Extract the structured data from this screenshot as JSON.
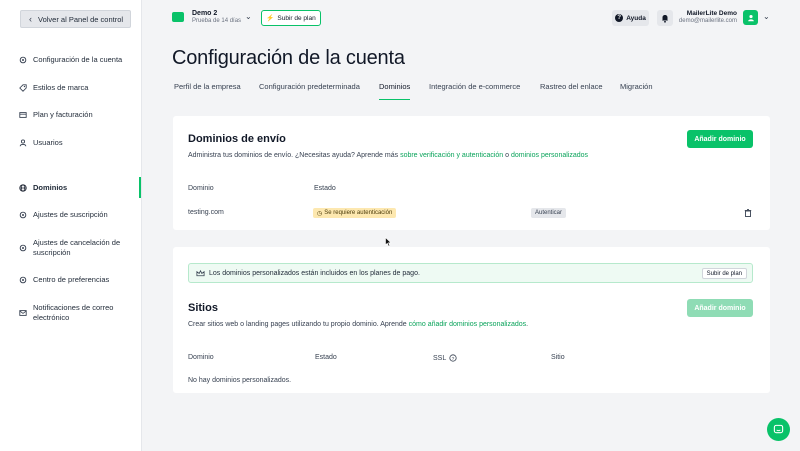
{
  "sidebar": {
    "back_label": "Volver al Panel de control",
    "items": [
      {
        "label": "Configuración de la cuenta",
        "icon": "gear-icon"
      },
      {
        "label": "Estilos de marca",
        "icon": "tag-icon"
      },
      {
        "label": "Plan y facturación",
        "icon": "card-icon"
      },
      {
        "label": "Usuarios",
        "icon": "user-icon"
      },
      {
        "label": "Dominios",
        "icon": "globe-icon",
        "active": true
      },
      {
        "label": "Ajustes de suscripción",
        "icon": "gear-icon"
      },
      {
        "label": "Ajustes de cancelación de suscripción",
        "icon": "gear-icon"
      },
      {
        "label": "Centro de preferencias",
        "icon": "gear-icon"
      },
      {
        "label": "Notificaciones de correo electrónico",
        "icon": "mail-icon"
      }
    ]
  },
  "topbar": {
    "account_name": "Demo 2",
    "account_trial": "Prueba de 14 días",
    "upgrade_label": "Subir de plan",
    "help_label": "Ayuda",
    "user_name": "MailerLite Demo",
    "user_email": "demo@mailerlite.com"
  },
  "page": {
    "title": "Configuración de la cuenta",
    "tabs": [
      {
        "label": "Perfil de la empresa"
      },
      {
        "label": "Configuración predeterminada"
      },
      {
        "label": "Dominios",
        "active": true
      },
      {
        "label": "Integración de e-commerce"
      },
      {
        "label": "Rastreo del enlace"
      },
      {
        "label": "Migración"
      }
    ]
  },
  "sending_domains": {
    "title": "Dominios de envío",
    "desc_prefix": "Administra tus dominios de envío. ¿Necesitas ayuda? Aprende más ",
    "link1": "sobre verificación y autenticación",
    "desc_mid": " o ",
    "link2": "dominios personalizados",
    "add_button": "Añadir dominio",
    "columns": [
      "Dominio",
      "Estado"
    ],
    "rows": [
      {
        "domain": "testing.com",
        "status": "Se requiere autenticación",
        "action": "Autenticar"
      }
    ]
  },
  "sites": {
    "banner_text": "Los dominios personalizados están incluidos en los planes de pago.",
    "banner_button": "Subir de plan",
    "title": "Sitios",
    "desc_prefix": "Crear sitios web o landing pages utilizando tu propio dominio. Aprende ",
    "link": "cómo añadir dominios personalizados",
    "desc_suffix": ".",
    "add_button": "Añadir dominio",
    "columns": [
      "Dominio",
      "Estado",
      "SSL",
      "Sitio"
    ],
    "empty_text": "No hay dominios personalizados."
  },
  "colors": {
    "accent": "#09c269",
    "badge_warning": "#fde8b0"
  }
}
